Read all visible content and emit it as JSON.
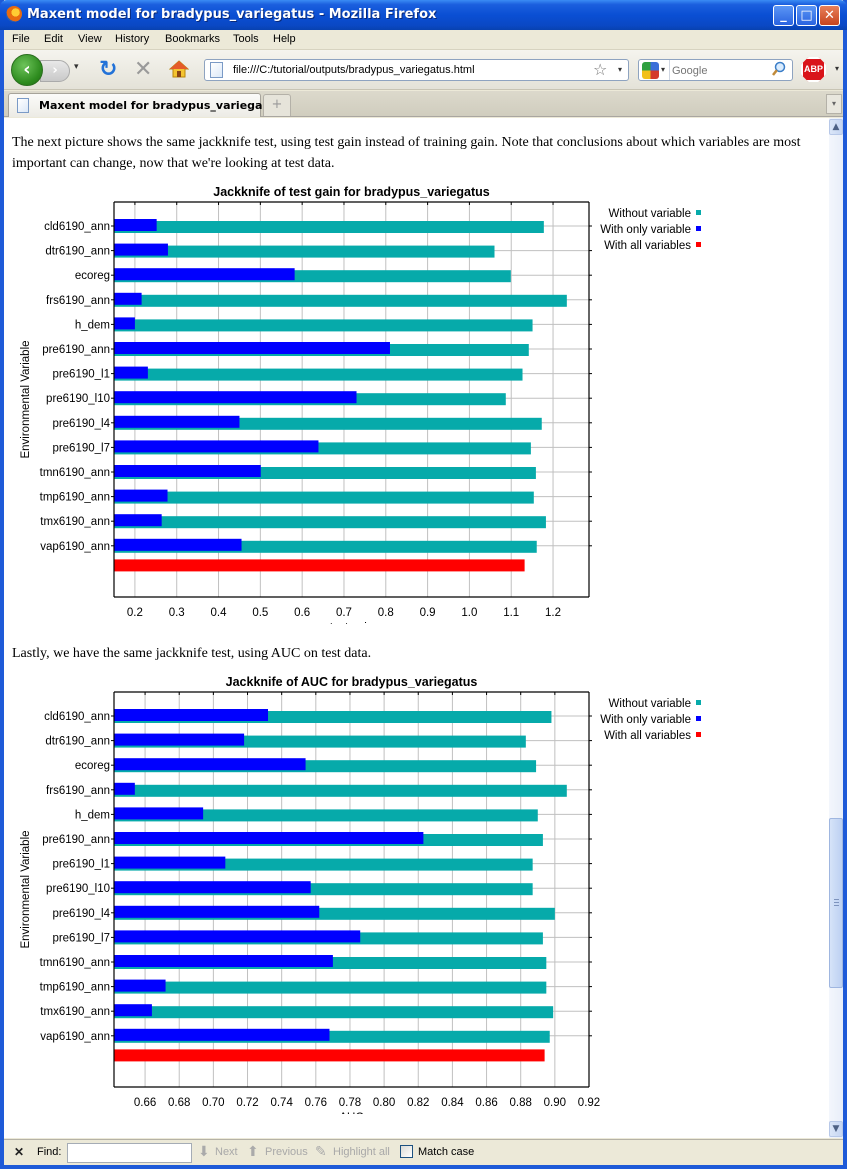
{
  "window": {
    "title": "Maxent model for bradypus_variegatus - Mozilla Firefox",
    "controls": {
      "minimize": "_",
      "maximize": "□",
      "close": "✕"
    }
  },
  "menu": [
    "File",
    "Edit",
    "View",
    "History",
    "Bookmarks",
    "Tools",
    "Help"
  ],
  "nav": {
    "url": "file:///C:/tutorial/outputs/bradypus_variegatus.html",
    "search_placeholder": "Google",
    "abp_label": "ABP",
    "icons": {
      "back": "‹",
      "forward": "›",
      "reload": "↻",
      "stop": "✕",
      "dropdown": "▾",
      "bookmark": "☆",
      "search": "🔍"
    }
  },
  "tabs": [
    {
      "title": "Maxent model for bradypus_variega...",
      "active": true
    }
  ],
  "new_tab_label": "+",
  "content": {
    "para1": "The next picture shows the same jackknife test, using test gain instead of training gain. Note that conclusions about which variables are most important can change, now that we're looking at test data.",
    "para2": "Lastly, we have the same jackknife test, using AUC on test data."
  },
  "colors": {
    "without": "#06aaaa",
    "with_only": "#0000ff",
    "with_all": "#ff0000",
    "grid": "#c0c0c0"
  },
  "chart_data": [
    {
      "type": "bar",
      "orientation": "horizontal",
      "title": "Jackknife of test gain for bradypus_variegatus",
      "xlabel": "test gain",
      "ylabel": "Environmental Variable",
      "xlim": [
        0.15,
        1.286
      ],
      "xticks": [
        "0.2",
        "0.3",
        "0.4",
        "0.5",
        "0.6",
        "0.7",
        "0.8",
        "0.9",
        "1.0",
        "1.1",
        "1.2"
      ],
      "xtick_values": [
        0.2,
        0.3,
        0.4,
        0.5,
        0.6,
        0.7,
        0.8,
        0.9,
        1.0,
        1.1,
        1.2
      ],
      "grid": true,
      "legend": {
        "position": "right",
        "entries": [
          "Without variable",
          "With only variable",
          "With all variables"
        ]
      },
      "categories": [
        "cld6190_ann",
        "dtr6190_ann",
        "ecoreg",
        "frs6190_ann",
        "h_dem",
        "pre6190_ann",
        "pre6190_l1",
        "pre6190_l10",
        "pre6190_l4",
        "pre6190_l7",
        "tmn6190_ann",
        "tmp6190_ann",
        "tmx6190_ann",
        "vap6190_ann"
      ],
      "series": [
        {
          "name": "Without variable",
          "values": [
            1.178,
            1.06,
            1.099,
            1.233,
            1.151,
            1.142,
            1.127,
            1.087,
            1.173,
            1.147,
            1.159,
            1.154,
            1.183,
            1.161
          ]
        },
        {
          "name": "With only variable",
          "values": [
            0.252,
            0.279,
            0.582,
            0.216,
            0.2,
            0.81,
            0.231,
            0.73,
            0.45,
            0.639,
            0.501,
            0.278,
            0.264,
            0.455
          ]
        }
      ],
      "with_all_variables": 1.132
    },
    {
      "type": "bar",
      "orientation": "horizontal",
      "title": "Jackknife of AUC for bradypus_variegatus",
      "xlabel": "AUC",
      "ylabel": "Environmental Variable",
      "xlim": [
        0.6418,
        0.92
      ],
      "xticks": [
        "0.66",
        "0.68",
        "0.70",
        "0.72",
        "0.74",
        "0.76",
        "0.78",
        "0.80",
        "0.82",
        "0.84",
        "0.86",
        "0.88",
        "0.90",
        "0.92"
      ],
      "xtick_values": [
        0.66,
        0.68,
        0.7,
        0.72,
        0.74,
        0.76,
        0.78,
        0.8,
        0.82,
        0.84,
        0.86,
        0.88,
        0.9,
        0.92
      ],
      "grid": true,
      "legend": {
        "position": "right",
        "entries": [
          "Without variable",
          "With only variable",
          "With all variables"
        ]
      },
      "categories": [
        "cld6190_ann",
        "dtr6190_ann",
        "ecoreg",
        "frs6190_ann",
        "h_dem",
        "pre6190_ann",
        "pre6190_l1",
        "pre6190_l10",
        "pre6190_l4",
        "pre6190_l7",
        "tmn6190_ann",
        "tmp6190_ann",
        "tmx6190_ann",
        "vap6190_ann"
      ],
      "series": [
        {
          "name": "Without variable",
          "values": [
            0.898,
            0.883,
            0.889,
            0.907,
            0.89,
            0.893,
            0.887,
            0.887,
            0.9,
            0.893,
            0.895,
            0.895,
            0.899,
            0.897
          ]
        },
        {
          "name": "With only variable",
          "values": [
            0.732,
            0.718,
            0.754,
            0.654,
            0.694,
            0.823,
            0.707,
            0.757,
            0.762,
            0.786,
            0.77,
            0.672,
            0.664,
            0.768
          ]
        }
      ],
      "with_all_variables": 0.894
    }
  ],
  "findbar": {
    "close": "✕",
    "label": "Find:",
    "value": "",
    "next": "Next",
    "previous": "Previous",
    "highlight": "Highlight all",
    "match_case": "Match case"
  }
}
